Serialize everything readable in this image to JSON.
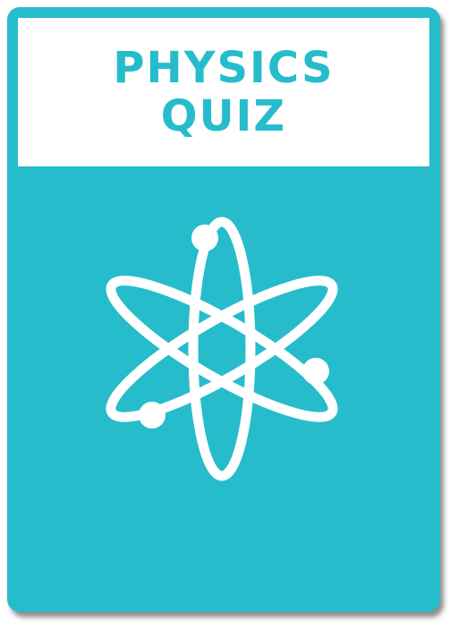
{
  "card": {
    "title_line1": "PHYSICS",
    "title_line2": "QUIZ",
    "icon": "atom-icon",
    "accent_color": "#26bccb",
    "header_background": "#ffffff"
  }
}
